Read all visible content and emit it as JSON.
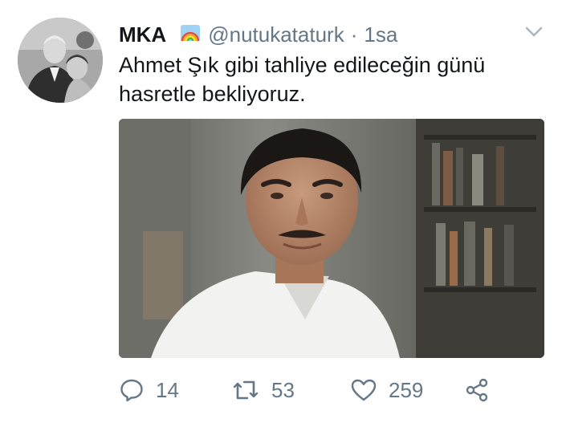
{
  "tweet": {
    "display_name": "MKA",
    "handle": "@nutukataturk",
    "separator": "·",
    "time": "1sa",
    "text": "Ahmet Şık gibi tahliye edileceğin günü hasretle bekliyoruz.",
    "rainbow_icon": "rainbow-flag-icon",
    "menu_icon": "chevron-down-icon"
  },
  "actions": {
    "reply_count": "14",
    "retweet_count": "53",
    "like_count": "259"
  },
  "colors": {
    "text": "#14171a",
    "secondary": "#657786",
    "background": "#ffffff"
  }
}
